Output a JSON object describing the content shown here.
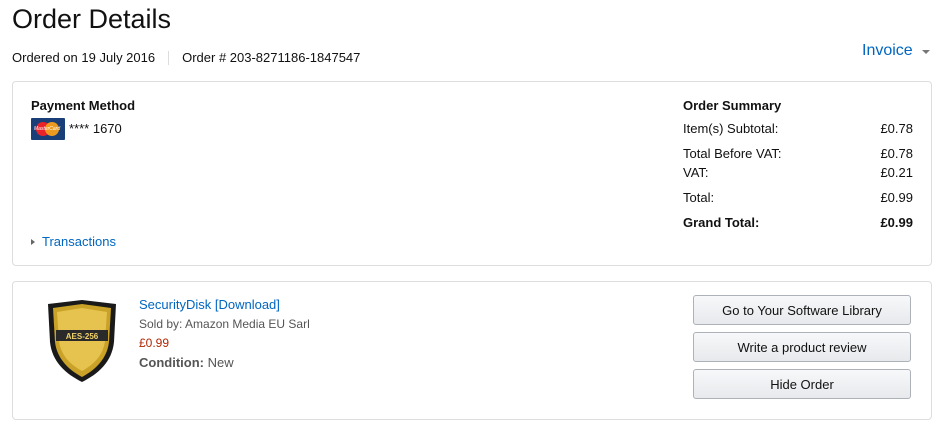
{
  "page": {
    "title": "Order Details",
    "ordered_on": "Ordered on 19 July 2016",
    "order_number": "Order # 203-8271186-1847547",
    "invoice_label": "Invoice"
  },
  "payment": {
    "title": "Payment Method",
    "card_brand": "MasterCard",
    "card_number": "**** 1670",
    "transactions_label": "Transactions"
  },
  "summary": {
    "title": "Order Summary",
    "rows": [
      {
        "label": "Item(s) Subtotal:",
        "value": "£0.78"
      },
      {
        "label": "Total Before VAT:",
        "value": "£0.78"
      },
      {
        "label": "VAT:",
        "value": "£0.21"
      },
      {
        "label": "Total:",
        "value": "£0.99"
      },
      {
        "label": "Grand Total:",
        "value": "£0.99"
      }
    ]
  },
  "item": {
    "logo_text": "AES-256",
    "name": "SecurityDisk [Download]",
    "sold_by": "Sold by: Amazon Media EU Sarl",
    "price": "£0.99",
    "condition_label": "Condition:",
    "condition_value": "New"
  },
  "actions": {
    "library": "Go to Your Software Library",
    "review": "Write a product review",
    "hide": "Hide Order"
  },
  "colors": {
    "link": "#0066c0",
    "price": "#b12704",
    "border": "#dddddd"
  }
}
